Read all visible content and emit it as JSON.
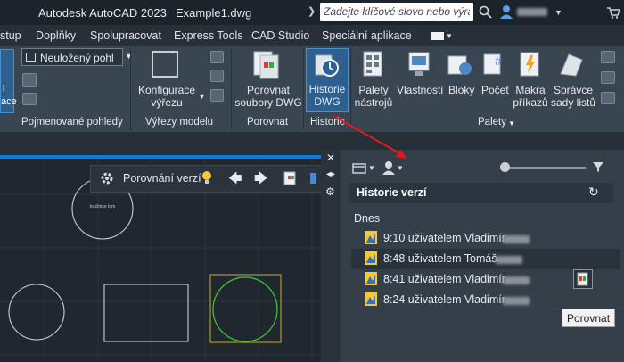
{
  "window": {
    "app_title": "Autodesk AutoCAD 2023",
    "file_name": "Example1.dwg",
    "search_placeholder": "Zadejte klíčové slovo nebo výraz."
  },
  "menu_tabs": [
    "stup",
    "Doplňky",
    "Spolupracovat",
    "Express Tools",
    "CAD Studio",
    "Speciální aplikace"
  ],
  "ribbon": {
    "view_dropdown_value": "Neuložený pohl",
    "left_cut_label_1": "l",
    "left_cut_label_2": "ace",
    "buttons": {
      "konfigurace": [
        "Konfigurace",
        "výřezu"
      ],
      "porovnat": [
        "Porovnat",
        "soubory DWG"
      ],
      "historie": [
        "Historie",
        "DWG"
      ],
      "palety": [
        "Palety",
        "nástrojů"
      ],
      "vlastnosti": "Vlastnosti",
      "bloky": "Bloky",
      "pocet": "Počet",
      "makra": [
        "Makra",
        "příkazů"
      ],
      "spravce": [
        "Správce",
        "sady listů"
      ]
    },
    "groups": {
      "pohledy": "Pojmenované pohledy",
      "vyrezy": "Výřezy modelu",
      "porovnat": "Porovnat",
      "historie": "Historie",
      "palety": "Palety"
    }
  },
  "toolbar": {
    "label": "Porovnání verzí"
  },
  "canvas": {
    "circle_text": "kružnice tom"
  },
  "history_palette": {
    "title": "Historie verzí",
    "section": "Dnes",
    "entries": [
      {
        "text": "9:10 uživatelem Vladimír"
      },
      {
        "text": "8:48 uživatelem Tomáš"
      },
      {
        "text": "8:41 uživatelem Vladimír"
      },
      {
        "text": "8:24 uživatelem Vladimír"
      }
    ],
    "tooltip": "Porovnat"
  },
  "colors": {
    "accent_blue": "#0a7ae6",
    "arrow_red": "#e11a1a",
    "highlight_green": "#38d030",
    "highlight_yellow": "#b8a32a"
  }
}
